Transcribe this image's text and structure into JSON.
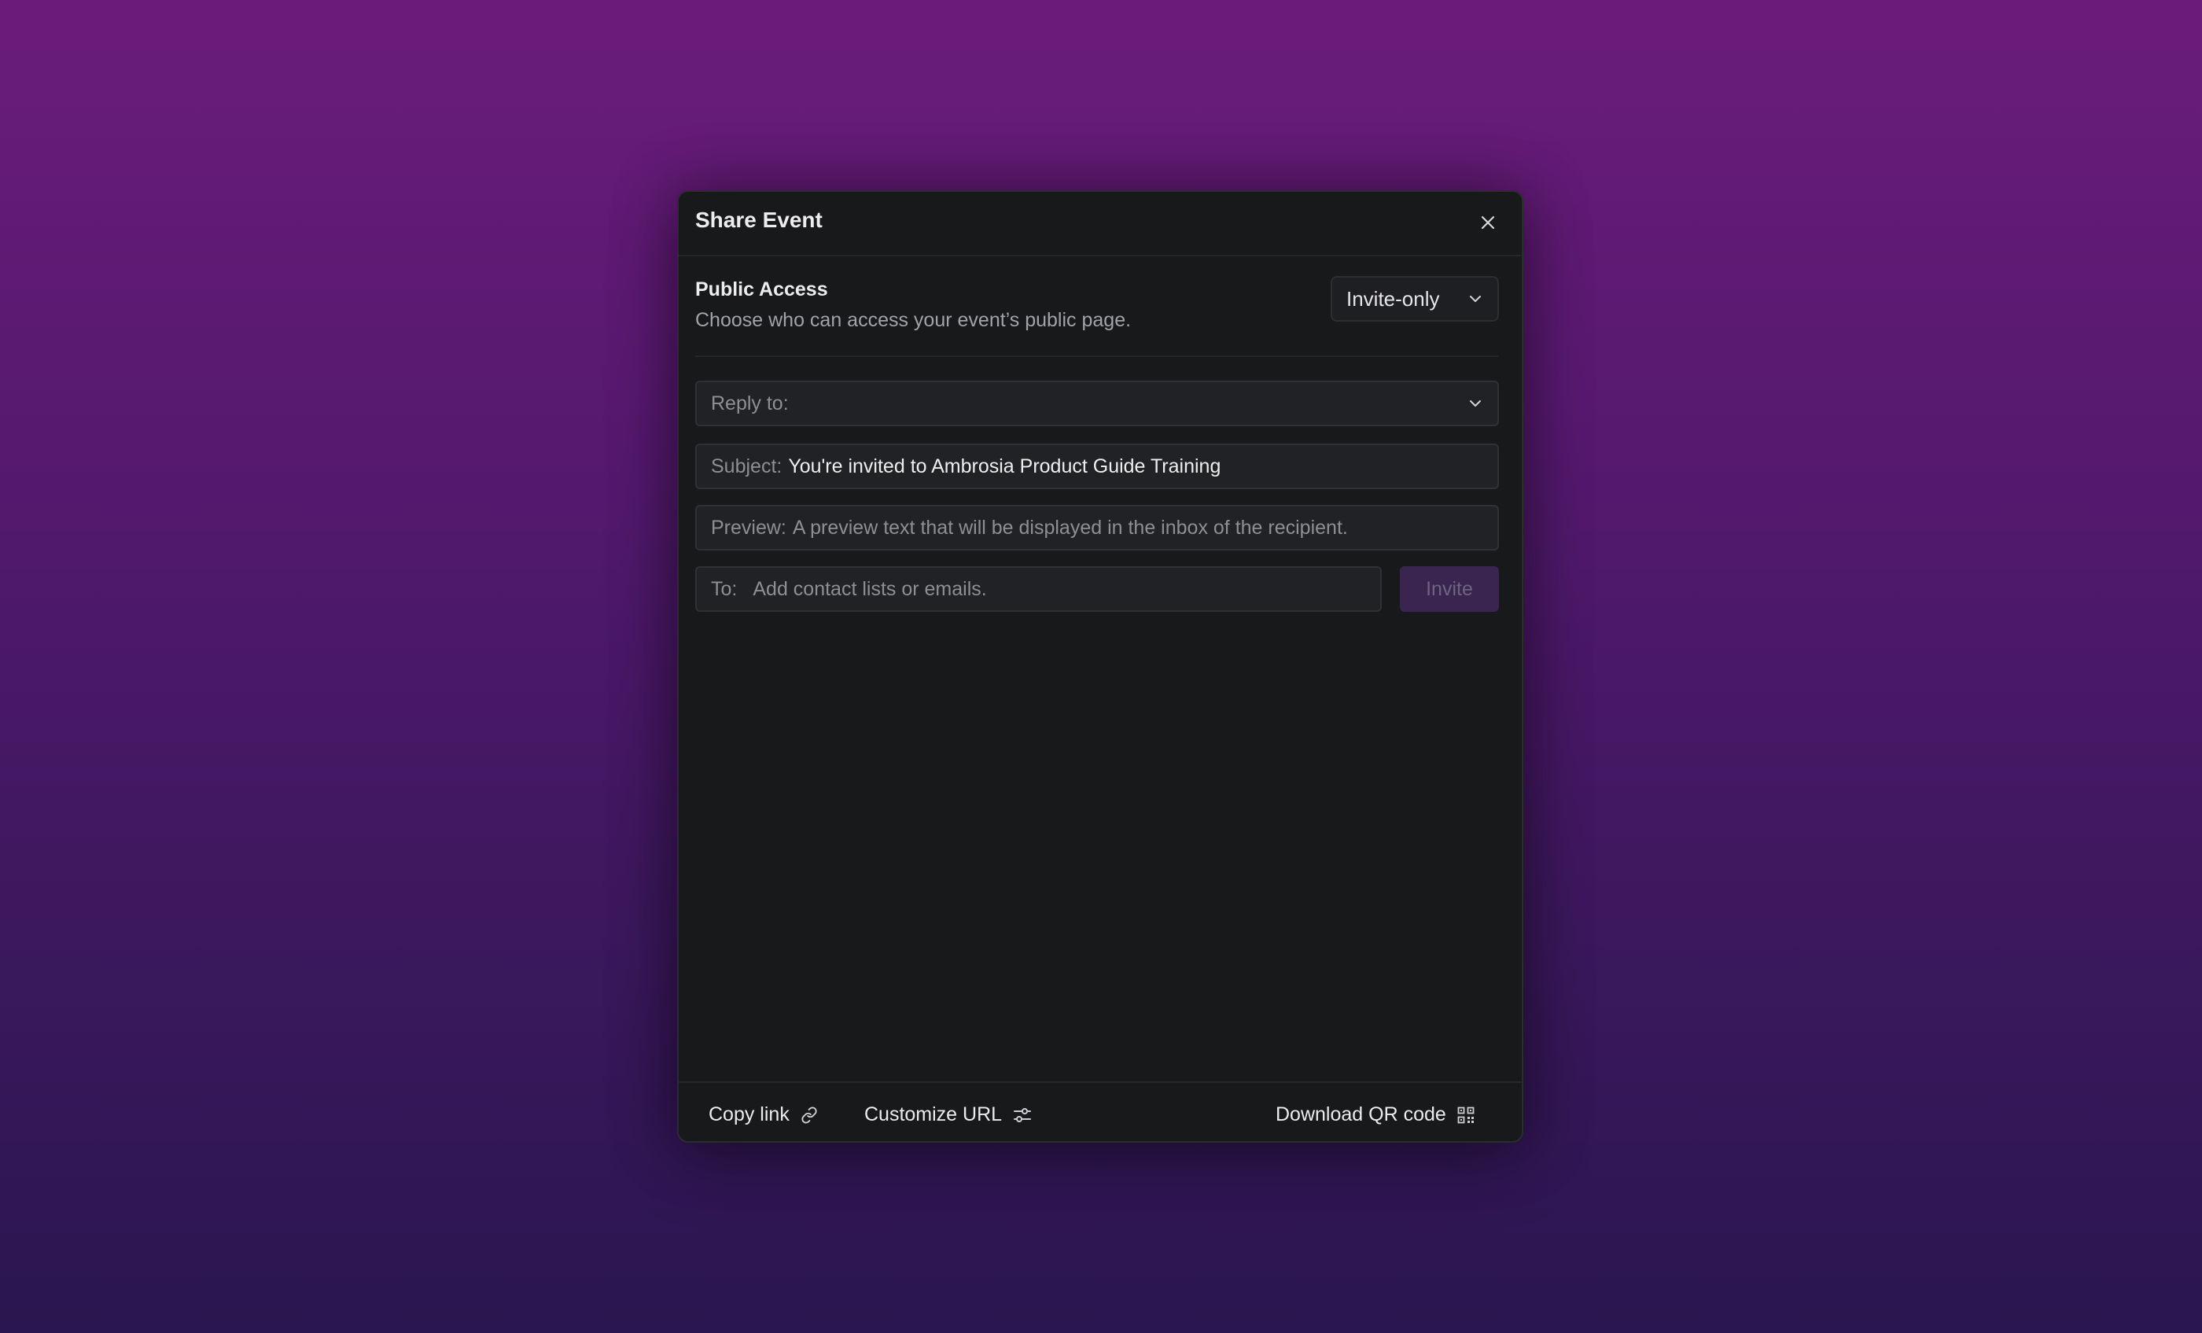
{
  "dialog": {
    "title": "Share Event",
    "close_icon": "close-icon"
  },
  "public_access": {
    "heading": "Public Access",
    "description": "Choose who can access your event’s public page.",
    "selected": "Invite-only"
  },
  "form": {
    "reply_to_label": "Reply to:",
    "subject_label": "Subject:",
    "subject_value": "You're invited to Ambrosia Product Guide Training",
    "preview_label": "Preview:",
    "preview_placeholder": "A preview text that will be displayed in the inbox of the recipient.",
    "to_label": "To:",
    "to_placeholder": "Add contact lists or emails.",
    "invite_label": "Invite"
  },
  "footer": {
    "copy_link_label": "Copy link",
    "customize_url_label": "Customize URL",
    "download_qr_label": "Download QR code"
  },
  "colors": {
    "background_top": "#6b1c7b",
    "background_bottom": "#2a1650",
    "modal_bg": "#18191b",
    "invite_button_bg": "#3a2450"
  }
}
